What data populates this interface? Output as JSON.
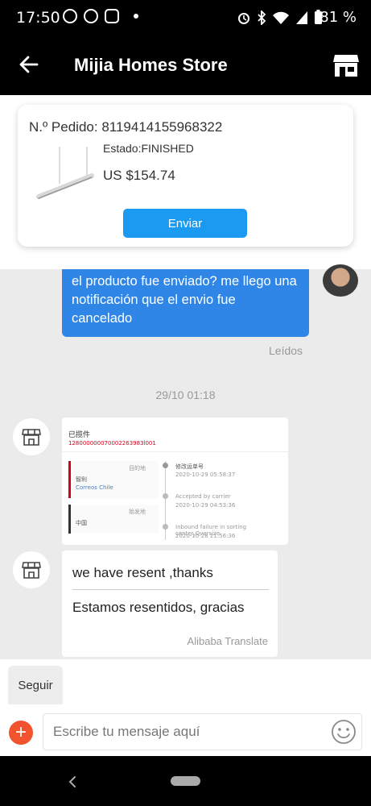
{
  "status_bar": {
    "time": "17:50",
    "battery": "81 %"
  },
  "header": {
    "title": "Mijia Homes Store"
  },
  "order": {
    "number_label": "N.º Pedido: 8119414155968322",
    "status": "Estado:FINISHED",
    "price": "US $154.74",
    "send_label": "Enviar"
  },
  "messages": {
    "outgoing_text": "el producto fue enviado? me llego una notificación que el envio fue cancelado",
    "read_label": "Leídos",
    "date_divider": "29/10 01:18",
    "image_message": {
      "title": "已揽件",
      "tracking": "128000000070002263983l001",
      "dest_label": "目的地",
      "dest_country": "智利",
      "dest_carrier": "Correos Chile",
      "origin_label": "始发地",
      "origin_country": "中国",
      "events": [
        {
          "title": "修改运单号",
          "time": "2020-10-29 05:58:37"
        },
        {
          "title": "Accepted by carrier",
          "time": "2020-10-29 04:53:36"
        },
        {
          "title": "Inbound failure in sorting center,Oversize",
          "time": "2020-10-28 21:56:36"
        }
      ]
    },
    "incoming_text": "we have resent ,thanks",
    "incoming_translated": "Estamos resentidos, gracias",
    "translate_credit": "Alibaba Translate"
  },
  "quick_replies": {
    "follow": "Seguir"
  },
  "input": {
    "placeholder": "Escribe tu mensaje aquí"
  },
  "colors": {
    "accent": "#1a9af0",
    "outgoing_bubble": "#2f86e6",
    "add_button": "#f0532d"
  }
}
